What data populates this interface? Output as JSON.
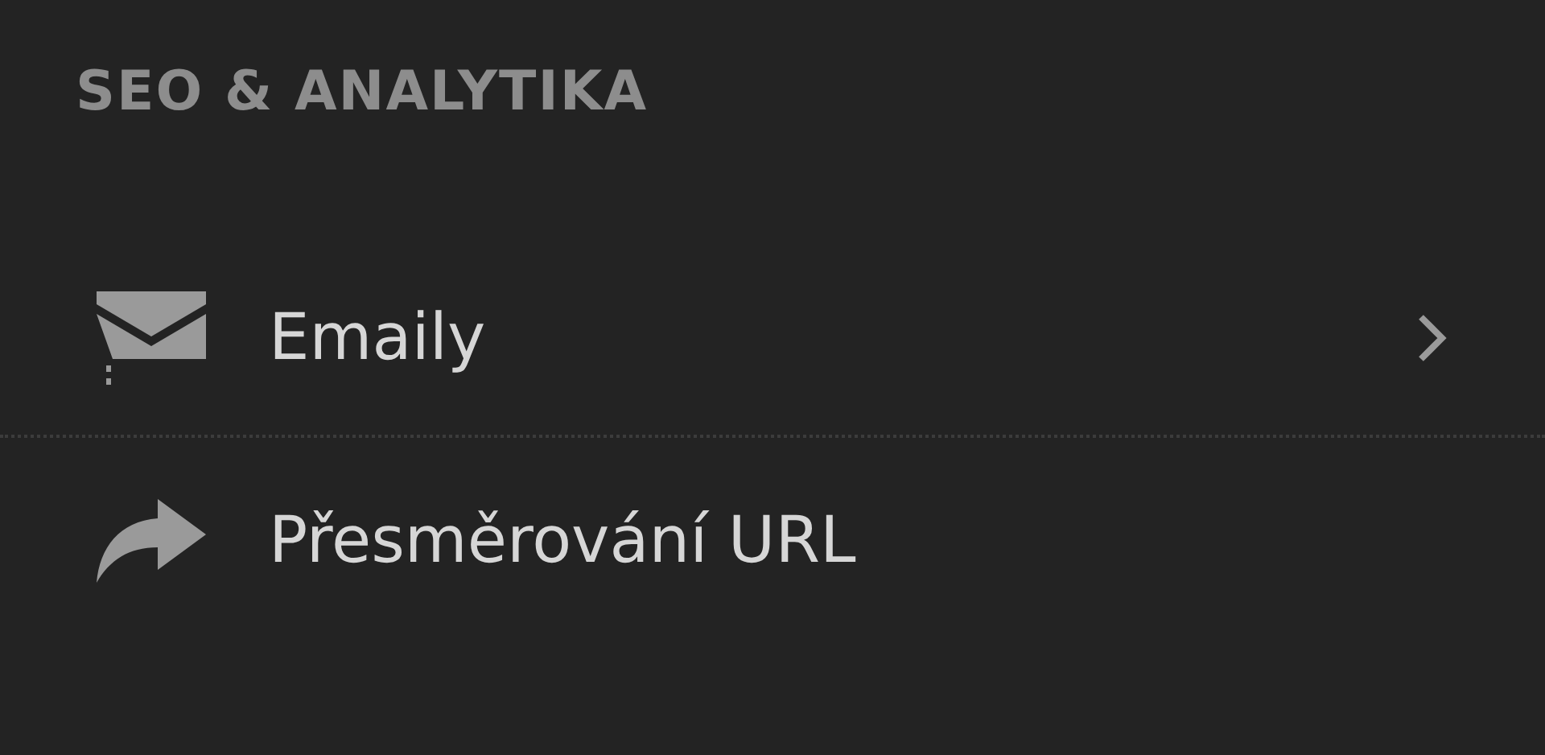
{
  "sidebar": {
    "section_title": "SEO & ANALYTIKA",
    "items": [
      {
        "label": "Emaily",
        "has_submenu": true
      },
      {
        "label": "Přesměrování URL",
        "has_submenu": false
      }
    ]
  }
}
